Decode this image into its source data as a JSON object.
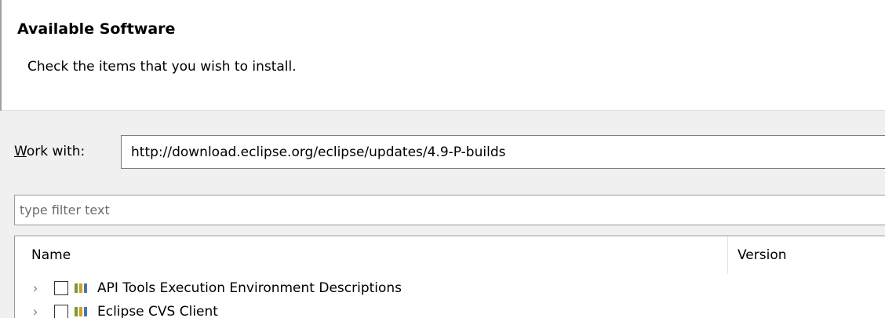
{
  "page": {
    "title": "Available Software",
    "description": "Check the items that you wish to install."
  },
  "work_with": {
    "label_initial": "W",
    "label_rest": "ork with:",
    "value": "http://download.eclipse.org/eclipse/updates/4.9-P-builds"
  },
  "filter": {
    "placeholder": "type filter text"
  },
  "table": {
    "columns": [
      "Name",
      "Version"
    ],
    "rows": [
      {
        "label": "API Tools Execution Environment Descriptions",
        "icon": "feature-icon"
      },
      {
        "label": "Eclipse CVS Client",
        "icon": "feature-icon"
      }
    ]
  },
  "colors": {
    "header_bg": "#ffffff",
    "body_bg": "#f0f0f0",
    "feature_green": "#7a9b30",
    "feature_gold": "#c9a32c",
    "feature_blue": "#4b73ad"
  }
}
